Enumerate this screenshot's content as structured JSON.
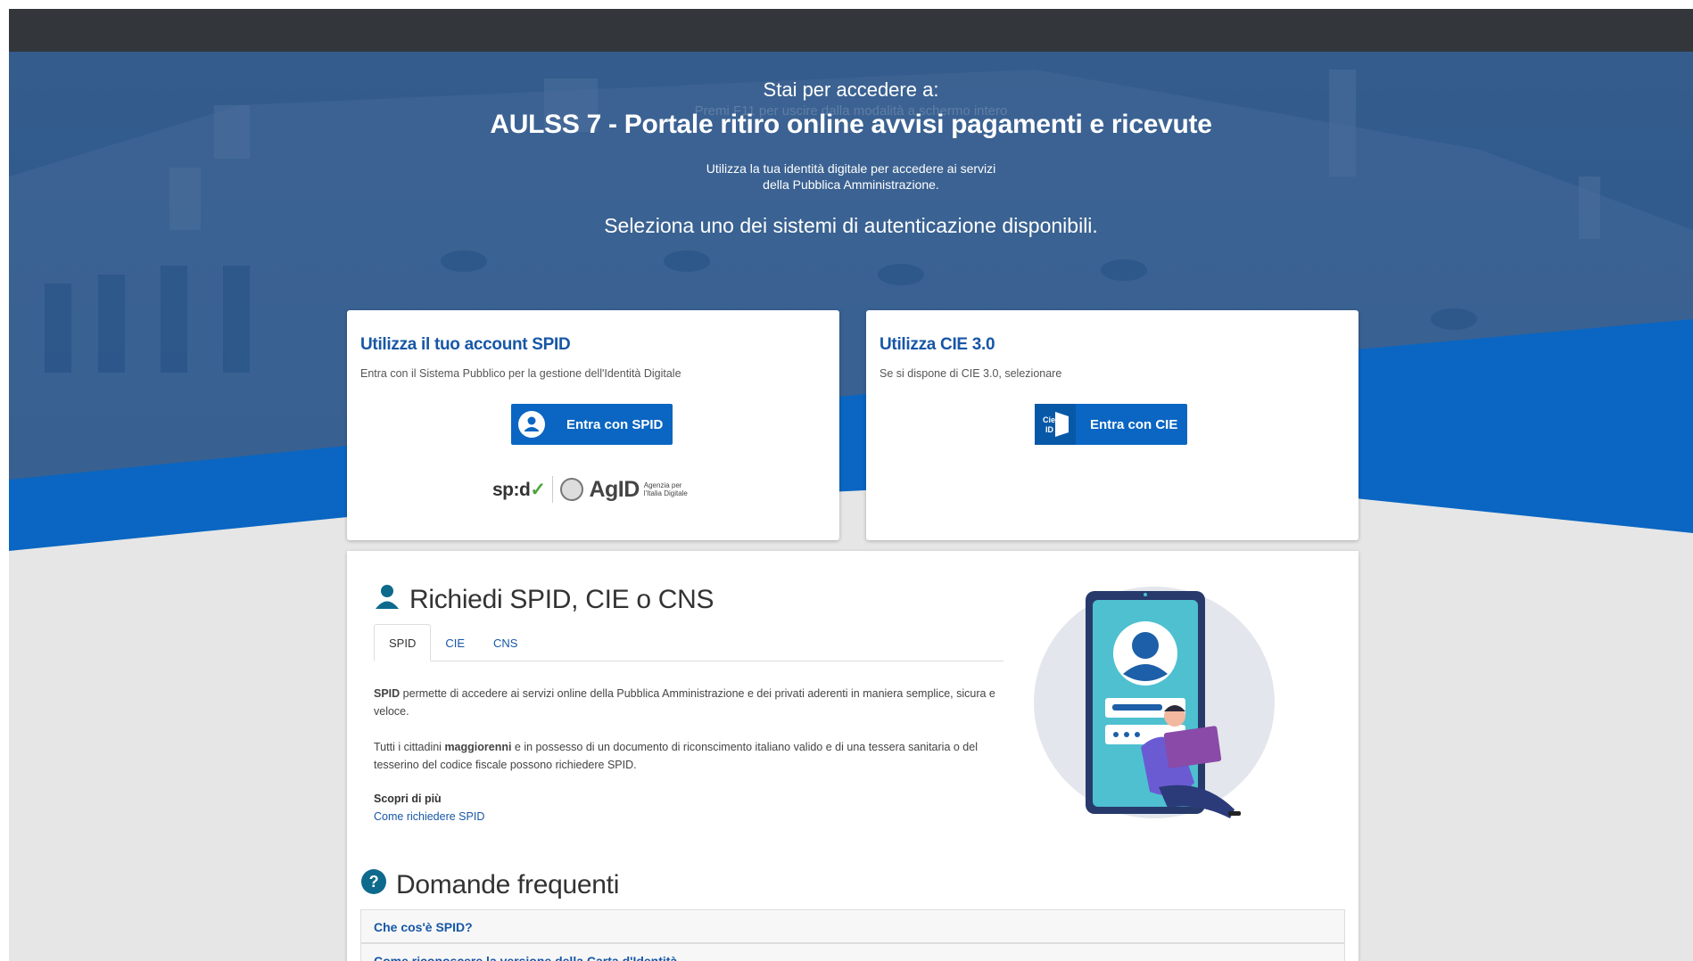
{
  "hero": {
    "fullscreen_hint": "Premi  F11  per uscire dalla modalità a schermo intero",
    "pre_title": "Stai per accedere a:",
    "service_title": "AULSS 7 - Portale ritiro online avvisi pagamenti e ricevute",
    "intro_line1": "Utilizza la tua identità digitale per accedere ai servizi",
    "intro_line2": "della Pubblica Amministrazione.",
    "select_prompt": "Seleziona uno dei sistemi di autenticazione disponibili."
  },
  "spid_card": {
    "title": "Utilizza il tuo account SPID",
    "subtitle": "Entra con il Sistema Pubblico per la gestione dell'Identità Digitale",
    "button_label": "Entra con SPID",
    "button_icon": "user-circle-icon",
    "logo_spid": "sp:d",
    "logo_agid": "AgID",
    "agid_line1": "Agenzia per",
    "agid_line2": "l'Italia Digitale"
  },
  "cie_card": {
    "title": "Utilizza CIE 3.0",
    "subtitle": "Se si dispone di CIE 3.0, selezionare",
    "button_label": "Entra con CIE",
    "button_icon": "cie-id-icon",
    "button_icon_text1": "Cie",
    "button_icon_text2": "ID"
  },
  "request": {
    "title": "Richiedi SPID, CIE o CNS",
    "tabs": [
      {
        "label": "SPID",
        "active": true
      },
      {
        "label": "CIE",
        "active": false
      },
      {
        "label": "CNS",
        "active": false
      }
    ],
    "p1_bold": "SPID",
    "p1_text": " permette di accedere ai servizi online della Pubblica Amministrazione e dei privati aderenti in maniera semplice, sicura e veloce.",
    "p2_text_a": "Tutti i cittadini ",
    "p2_bold": "maggiorenni",
    "p2_text_b": " e in possesso di un documento di riconscimento italiano valido e di una tessera sanitaria o del tesserino del codice fiscale possono richiedere SPID.",
    "more_title": "Scopri di più",
    "more_link": "Come richiedere SPID"
  },
  "faq": {
    "title": "Domande frequenti",
    "items": [
      {
        "label": "Che cos'è SPID?"
      },
      {
        "label": "Come riconoscere la versione della Carta d'Identità"
      }
    ]
  },
  "colors": {
    "topbar": "#33363b",
    "primary_blue": "#0a66c2",
    "link_blue": "#1757a6",
    "hero_overlay": "#1f4e86",
    "page_bg": "#e6e6e6"
  }
}
